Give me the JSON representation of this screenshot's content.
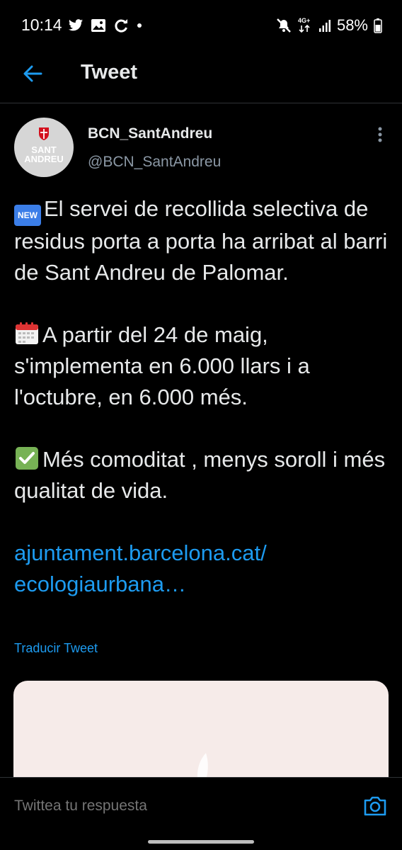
{
  "status_bar": {
    "time": "10:14",
    "network": "4G+",
    "battery": "58%",
    "icons": [
      "twitter-icon",
      "gallery-icon",
      "sync-icon",
      "dot-icon",
      "mute-icon",
      "signal-icon",
      "battery-icon"
    ]
  },
  "header": {
    "title": "Tweet",
    "back_icon": "arrow-left-icon"
  },
  "tweet": {
    "avatar_text": "SANT\nANDREU",
    "display_name": "BCN_SantAndreu",
    "handle": "@BCN_SantAndreu",
    "paragraph_1": "El servei de recollida selectiva de residus porta a porta ha arribat al barri de Sant Andreu de Palomar.",
    "paragraph_2": "A partir del 24 de maig, s'implementa en 6.000 llars i a l'octubre, en 6.000 més.",
    "paragraph_3": "Més comoditat , menys soroll i més qualitat de vida.",
    "link_line_1": "ajuntament.barcelona.cat/",
    "link_line_2": "ecologiaurbana…",
    "translate": "Traducir Tweet",
    "emoji_new": "NEW"
  },
  "reply": {
    "placeholder": "Twittea tu respuesta"
  },
  "colors": {
    "background": "#000000",
    "accent": "#1d9bf0",
    "text": "#e7e9ea",
    "secondary_text": "#8b98a5"
  }
}
